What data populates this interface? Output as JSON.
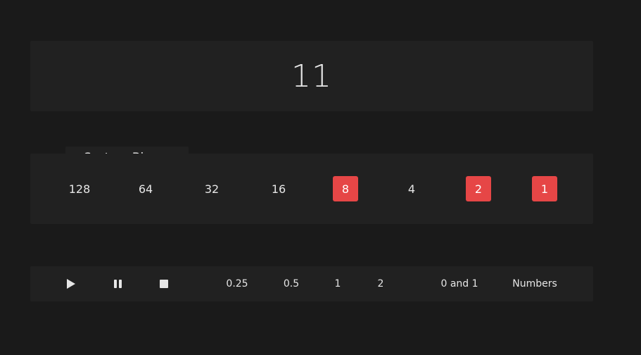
{
  "display": {
    "value": "11"
  },
  "binary": {
    "tab_label": "System Binarny",
    "bits": [
      {
        "label": "128",
        "active": false
      },
      {
        "label": "64",
        "active": false
      },
      {
        "label": "32",
        "active": false
      },
      {
        "label": "16",
        "active": false
      },
      {
        "label": "8",
        "active": true
      },
      {
        "label": "4",
        "active": false
      },
      {
        "label": "2",
        "active": true
      },
      {
        "label": "1",
        "active": true
      }
    ],
    "active_color": "#e64646"
  },
  "controls": {
    "play_icon": "play-icon",
    "pause_icon": "pause-icon",
    "stop_icon": "stop-icon",
    "speeds": [
      "0.25",
      "0.5",
      "1",
      "2"
    ],
    "mode_binary": "0 and 1",
    "mode_numbers": "Numbers"
  }
}
